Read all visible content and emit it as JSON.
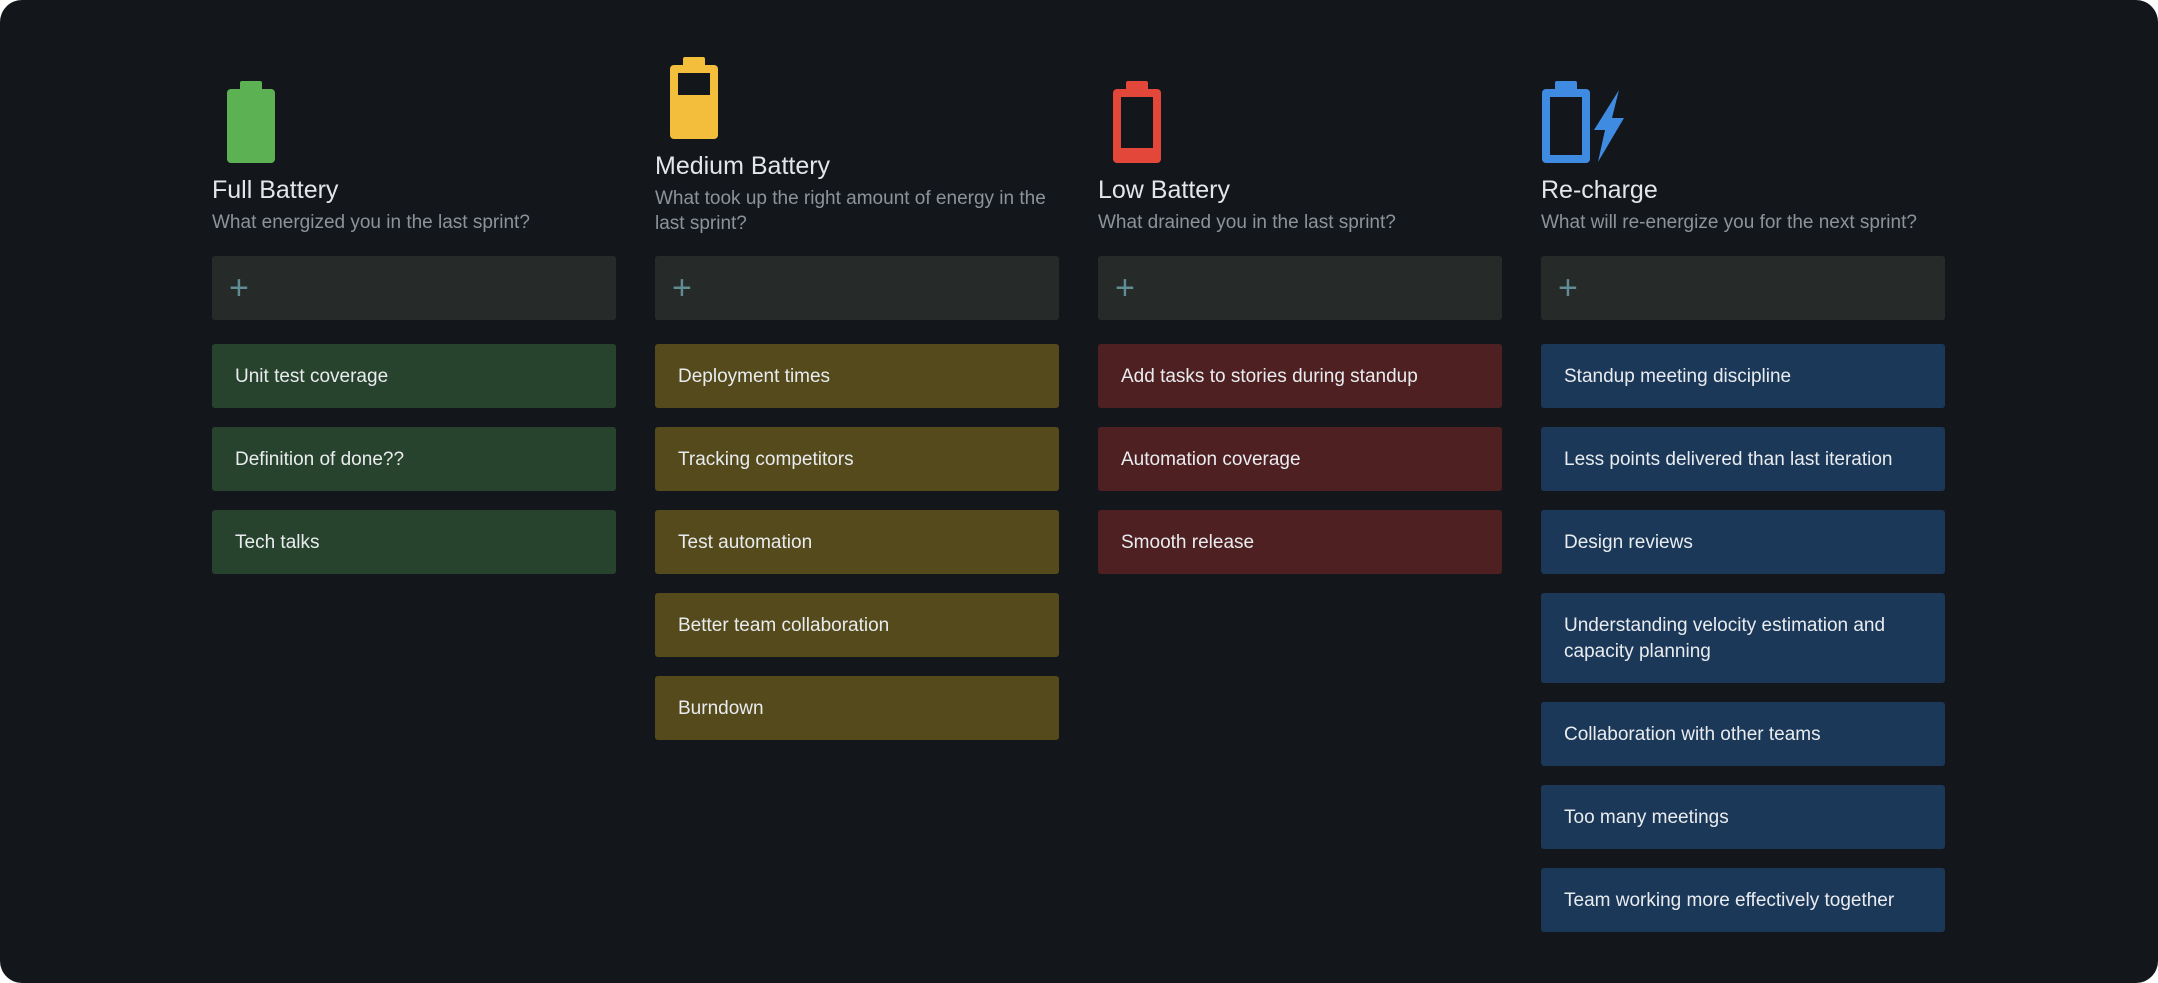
{
  "colors": {
    "background": "#13171b",
    "full": "#5cb253",
    "medium": "#f2be3c",
    "low": "#e2473a",
    "recharge": "#3f8be2"
  },
  "columns": [
    {
      "key": "full",
      "icon": "full-battery-icon",
      "title": "Full Battery",
      "subtitle": "What energized you in the last sprint?",
      "add_label": "+",
      "cards": [
        "Unit test coverage",
        "Definition of done??",
        "Tech talks"
      ]
    },
    {
      "key": "medium",
      "icon": "medium-battery-icon",
      "title": "Medium Battery",
      "subtitle": "What took up the right amount of energy in the last sprint?",
      "add_label": "+",
      "cards": [
        "Deployment times",
        "Tracking competitors",
        "Test automation",
        "Better team collaboration",
        "Burndown"
      ]
    },
    {
      "key": "low",
      "icon": "low-battery-icon",
      "title": "Low Battery",
      "subtitle": "What drained you in the last sprint?",
      "add_label": "+",
      "cards": [
        "Add tasks to stories during standup",
        "Automation coverage",
        "Smooth release"
      ]
    },
    {
      "key": "recharge",
      "icon": "recharge-battery-icon",
      "title": "Re-charge",
      "subtitle": "What will re-energize you for the next sprint?",
      "add_label": "+",
      "cards": [
        "Standup meeting discipline",
        "Less points delivered than last iteration",
        "Design reviews",
        "Understanding velocity estimation and capacity planning",
        "Collaboration with other teams",
        "Too many meetings",
        "Team working more effectively together"
      ]
    }
  ]
}
